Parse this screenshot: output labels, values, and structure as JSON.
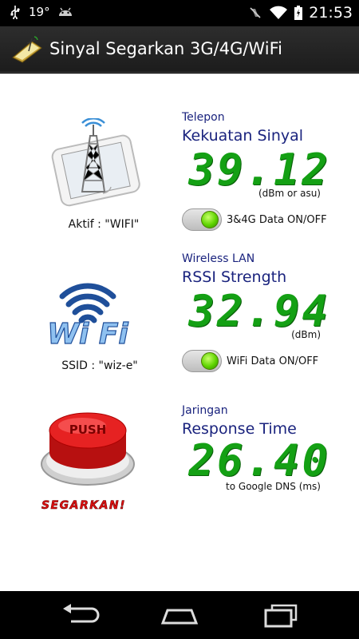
{
  "status_bar": {
    "usb_icon": "usb-icon",
    "temperature": "19°",
    "android_icon": "android-icon",
    "mute_icon": "mute-icon",
    "wifi_icon": "wifi-icon",
    "battery_icon": "battery-icon",
    "time": "21:53"
  },
  "action_bar": {
    "icon": "app-signal-icon",
    "title": "Sinyal Segarkan 3G/4G/WiFi"
  },
  "phone_section": {
    "caption": "Aktif : \"WIFI\"",
    "small_label": "Telepon",
    "title": "Kekuatan Sinyal",
    "value": "39.12",
    "unit": "(dBm or asu)",
    "toggle_label": "3&4G Data ON/OFF",
    "toggle_on": true
  },
  "wifi_section": {
    "logo_text": "Wi Fi",
    "caption": "SSID : \"wiz-e\"",
    "small_label": "Wireless LAN",
    "title": "RSSI Strength",
    "value": "32.94",
    "unit": "(dBm)",
    "toggle_label": "WiFi Data ON/OFF",
    "toggle_on": true
  },
  "ping_section": {
    "button_text": "PUSH",
    "button_caption": "SEGARKAN!",
    "small_label": "Jaringan",
    "title": "Response Time",
    "value": "26.40",
    "unit": "to Google DNS (ms)"
  },
  "nav_bar": {
    "back_icon": "back-icon",
    "home_icon": "home-icon",
    "recents_icon": "recents-icon"
  },
  "colors": {
    "value_green": "#14a014",
    "title_blue": "#1a237e",
    "push_red": "#d81b1b"
  }
}
